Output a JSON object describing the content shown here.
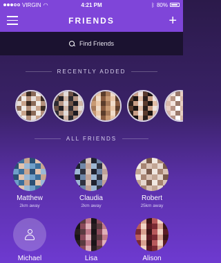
{
  "status_bar": {
    "carrier": "VIRGIN",
    "time": "4:21 PM",
    "battery": "80%"
  },
  "nav": {
    "title": "FRIENDS"
  },
  "search": {
    "label": "Find Friends"
  },
  "sections": {
    "recent_title": "RECENTLY ADDED",
    "all_title": "ALL FRIENDS"
  },
  "recent": [
    {
      "colors": [
        "#e8e0dc",
        "#c9a48c",
        "#3a2a22",
        "#8b6a58",
        "#f1ece8",
        "#b38f7a"
      ]
    },
    {
      "colors": [
        "#2c2a30",
        "#b59482",
        "#e2dbd9",
        "#6d5246",
        "#1e1c22",
        "#cfb4a4"
      ]
    },
    {
      "colors": [
        "#c89a74",
        "#e9c7a8",
        "#5b3d2b",
        "#a77a59",
        "#f0dcc9",
        "#8b5d40"
      ]
    },
    {
      "colors": [
        "#2a1f1c",
        "#c99e86",
        "#efe4de",
        "#5a3a2c",
        "#1c1513",
        "#e1bda7"
      ]
    },
    {
      "colors": [
        "#d8b9aa",
        "#f3e6df",
        "#9a7a6b",
        "#e7cec2",
        "#b79484",
        "#ffffff"
      ]
    }
  ],
  "friends": [
    {
      "name": "Matthew",
      "distance": "2km away",
      "colors": [
        "#6f9fc9",
        "#3d6f9c",
        "#c8a590",
        "#2b4f74",
        "#e2c3ae",
        "#9bb9d6"
      ]
    },
    {
      "name": "Claudia",
      "distance": "2km away",
      "colors": [
        "#9eb7d4",
        "#2f3140",
        "#d6c1b8",
        "#1f2230",
        "#6f86a8",
        "#c0a298"
      ]
    },
    {
      "name": "Robert",
      "distance": "25km away",
      "colors": [
        "#c2a594",
        "#e6d7cf",
        "#7a5a4b",
        "#f1e8e2",
        "#a78472",
        "#d9c2b6"
      ]
    },
    {
      "name": "Michael",
      "distance": "",
      "placeholder": true
    },
    {
      "name": "Lisa",
      "distance": "",
      "colors": [
        "#2a1e22",
        "#5a3a40",
        "#c07a8a",
        "#1a1418",
        "#8a4a5a",
        "#e0b0b8"
      ]
    },
    {
      "name": "Alison",
      "distance": "",
      "colors": [
        "#7a2a34",
        "#d8a090",
        "#3a1418",
        "#b85a5c",
        "#f0d2c4",
        "#5a1c24"
      ]
    }
  ]
}
